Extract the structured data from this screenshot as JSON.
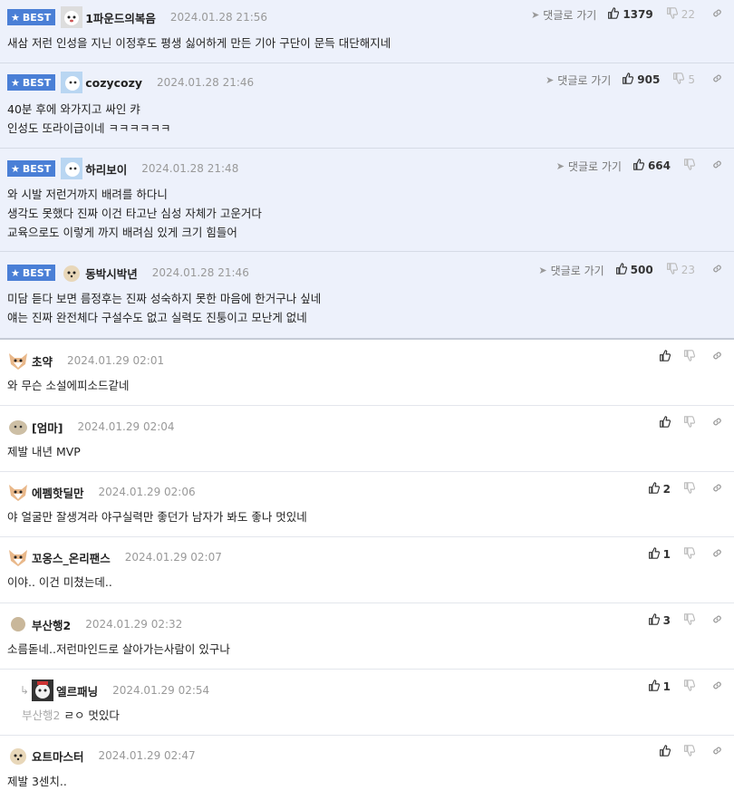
{
  "best_label": "BEST",
  "reply_link_label": "댓글로 가기",
  "best_comments": [
    {
      "nick": "1파운드의복음",
      "date": "2024.01.28 21:56",
      "lines": [
        "새삼 저런 인성을 지닌 이정후도 평생 싫어하게 만든 기아 구단이 문득 대단해지네"
      ],
      "up": "1379",
      "down": "22"
    },
    {
      "nick": "cozycozy",
      "date": "2024.01.28 21:46",
      "lines": [
        "40분 후에 와가지고 싸인 캬",
        "인성도 또라이급이네 ㅋㅋㅋㅋㅋㅋ"
      ],
      "up": "905",
      "down": "5"
    },
    {
      "nick": "하리보이",
      "date": "2024.01.28 21:48",
      "lines": [
        "와 시발 저런거까지 배려를 하다니",
        "생각도 못했다 진짜 이건 타고난 심성 자체가 고운거다",
        "교육으로도 이렇게 까지 배려심 있게 크기 힘들어"
      ],
      "up": "664",
      "down": ""
    },
    {
      "nick": "동박시박년",
      "date": "2024.01.28 21:46",
      "lines": [
        "미담 듣다 보면 름정후는 진짜 성숙하지 못한 마음에 한거구나 싶네",
        "얘는 진짜 완전체다 구설수도 없고 실력도 진퉁이고 모난게 없네"
      ],
      "up": "500",
      "down": "23"
    }
  ],
  "comments": [
    {
      "nick": "초약",
      "date": "2024.01.29 02:01",
      "text": "와 무슨 소설에피소드같네",
      "up": ""
    },
    {
      "nick": "[엄마]",
      "date": "2024.01.29 02:04",
      "text": "제발 내년 MVP",
      "up": ""
    },
    {
      "nick": "에펨핫딜만",
      "date": "2024.01.29 02:06",
      "text": "야 얼굴만 잘생겨라 야구실력만 좋던가 남자가 봐도 좋나 멋있네",
      "up": "2"
    },
    {
      "nick": "꼬옹스_온리팬스",
      "date": "2024.01.29 02:07",
      "text": "이야.. 이건 미쳤는데..",
      "up": "1"
    },
    {
      "nick": "부산행2",
      "date": "2024.01.29 02:32",
      "text": "소름돋네..저런마인드로 살아가는사람이 있구나",
      "up": "3"
    },
    {
      "nick": "엘르패닝",
      "date": "2024.01.29 02:54",
      "reply_to": "부산행2",
      "text": "ㄹㅇ 멋있다",
      "up": "1"
    },
    {
      "nick": "요트마스터",
      "date": "2024.01.29 02:47",
      "text": "제발 3센치..",
      "up": ""
    }
  ],
  "colors": {
    "best_bg": "#edf1fb",
    "badge": "#4a7fd6"
  },
  "icons": [
    "thumbs-up-icon",
    "thumbs-down-icon",
    "link-icon",
    "reply-arrow-icon",
    "star-icon"
  ]
}
